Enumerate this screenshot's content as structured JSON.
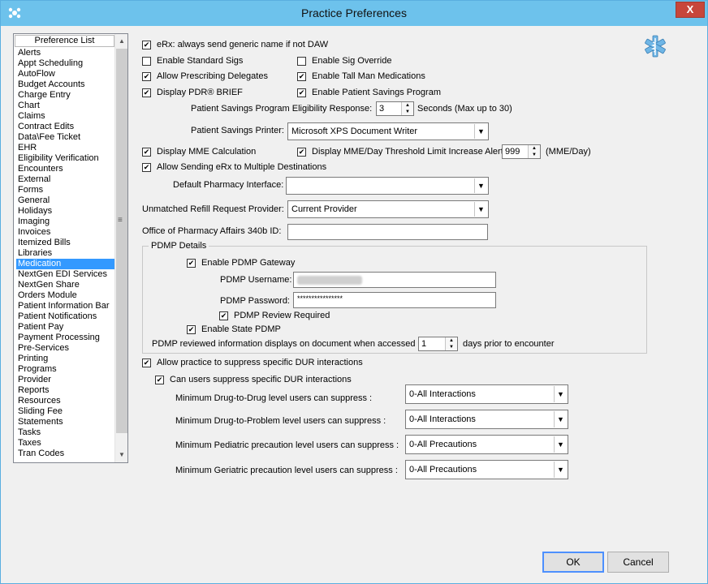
{
  "window": {
    "title": "Practice Preferences",
    "close_glyph": "X"
  },
  "list": {
    "header": "Preference List",
    "selected": "Medication",
    "items": [
      "Alerts",
      "Appt Scheduling",
      "AutoFlow",
      "Budget Accounts",
      "Charge Entry",
      "Chart",
      "Claims",
      "Contract Edits",
      "Data\\Fee Ticket",
      "EHR",
      "Eligibility Verification",
      "Encounters",
      "External",
      "Forms",
      "General",
      "Holidays",
      "Imaging",
      "Invoices",
      "Itemized Bills",
      "Libraries",
      "Medication",
      "NextGen EDI Services",
      "NextGen Share",
      "Orders Module",
      "Patient Information Bar",
      "Patient Notifications",
      "Patient Pay",
      "Payment Processing",
      "Pre-Services",
      "Printing",
      "Programs",
      "Provider",
      "Reports",
      "Resources",
      "Sliding Fee",
      "Statements",
      "Tasks",
      "Taxes",
      "Tran Codes"
    ]
  },
  "options": {
    "generic_name": {
      "label": "eRx: always send generic name if not DAW",
      "checked": true
    },
    "standard_sigs": {
      "label": "Enable Standard Sigs",
      "checked": false
    },
    "sig_override": {
      "label": "Enable Sig Override",
      "checked": false
    },
    "prescribing_delegates": {
      "label": "Allow Prescribing Delegates",
      "checked": true
    },
    "tall_man": {
      "label": "Enable Tall Man Medications",
      "checked": true
    },
    "pdr_brief": {
      "label": "Display PDR® BRIEF",
      "checked": true
    },
    "patient_savings": {
      "label": "Enable Patient Savings Program",
      "checked": true
    },
    "mme_calc": {
      "label": "Display MME Calculation",
      "checked": true
    },
    "mme_threshold": {
      "label": "Display MME/Day Threshold Limit Increase Alert",
      "checked": true
    },
    "multi_dest": {
      "label": "Allow Sending eRx to Multiple Destinations",
      "checked": true
    }
  },
  "savings": {
    "eligibility_label": "Patient Savings Program Eligibility Response:",
    "eligibility_value": "3",
    "seconds_label": "Seconds (Max up to 30)",
    "printer_label": "Patient Savings Printer:",
    "printer_value": "Microsoft XPS Document Writer"
  },
  "mme": {
    "value": "999",
    "unit": "(MME/Day)"
  },
  "pharmacy": {
    "default_interface_label": "Default Pharmacy Interface:",
    "default_interface_value": "",
    "refill_label": "Unmatched Refill Request Provider:",
    "refill_value": "Current Provider",
    "office_label": "Office of Pharmacy Affairs 340b ID:",
    "office_value": ""
  },
  "pdmp": {
    "group_label": "PDMP Details",
    "gateway": {
      "label": "Enable PDMP Gateway",
      "checked": true
    },
    "username_label": "PDMP Username:",
    "password_label": "PDMP Password:",
    "password_value": "****************",
    "review": {
      "label": "PDMP Review Required",
      "checked": true
    },
    "state": {
      "label": "Enable State PDMP",
      "checked": true
    },
    "reviewed_label": "PDMP reviewed information displays on document when accessed",
    "days_value": "1",
    "days_label": "days prior to encounter"
  },
  "dur": {
    "practice_suppress": {
      "label": "Allow practice to suppress specific DUR interactions",
      "checked": true
    },
    "users_suppress": {
      "label": "Can users suppress specific DUR interactions",
      "checked": true
    },
    "rows": [
      {
        "label": "Minimum Drug-to-Drug level users can suppress :",
        "value": "0-All Interactions"
      },
      {
        "label": "Minimum Drug-to-Problem level users can suppress :",
        "value": "0-All Interactions"
      },
      {
        "label": "Minimum Pediatric precaution level users can suppress :",
        "value": "0-All Precautions"
      },
      {
        "label": "Minimum Geriatric precaution level users can suppress :",
        "value": "0-All Precautions"
      }
    ]
  },
  "buttons": {
    "ok": "OK",
    "cancel": "Cancel"
  },
  "colors": {
    "titlebar": "#6dc2ec",
    "selection": "#3399ff",
    "close": "#c7463b"
  }
}
